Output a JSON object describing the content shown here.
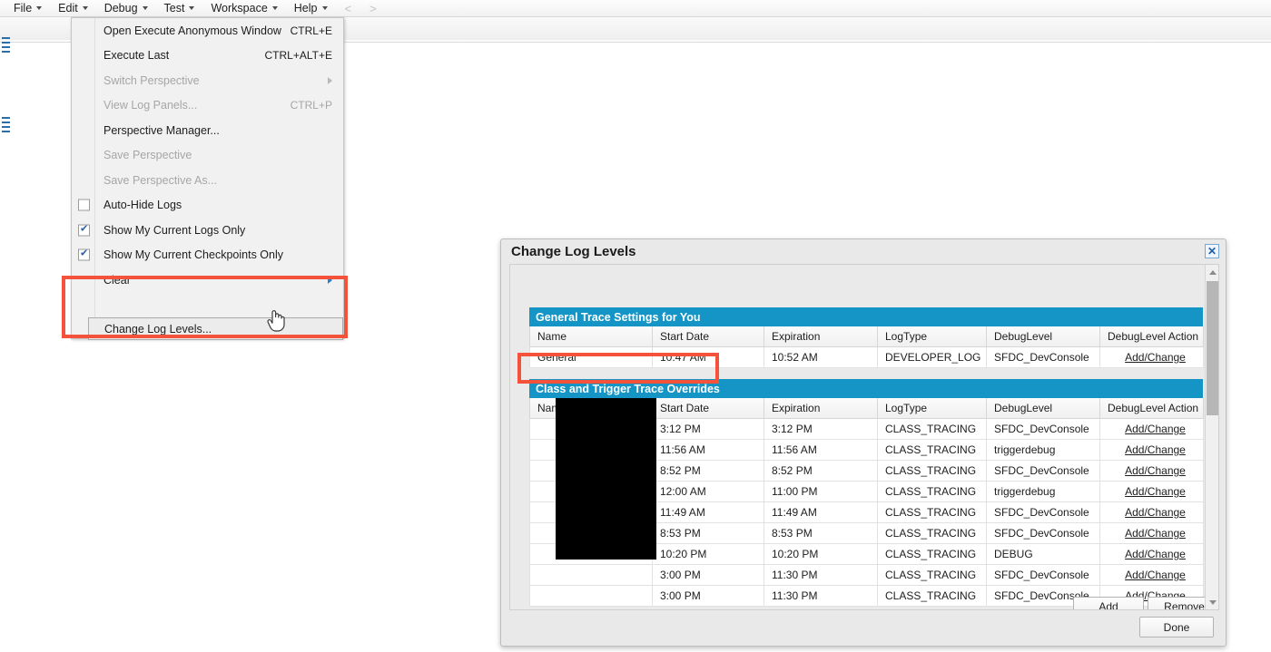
{
  "menubar": {
    "items": [
      {
        "label": "File"
      },
      {
        "label": "Edit"
      },
      {
        "label": "Debug"
      },
      {
        "label": "Test"
      },
      {
        "label": "Workspace"
      },
      {
        "label": "Help"
      }
    ],
    "nav_prev": "<",
    "nav_next": ">"
  },
  "debug_menu": {
    "items": [
      {
        "label": "Open Execute Anonymous Window",
        "accel": "CTRL+E",
        "disabled": false,
        "checkbox": null,
        "submenu": false
      },
      {
        "label": "Execute Last",
        "accel": "CTRL+ALT+E",
        "disabled": false,
        "checkbox": null,
        "submenu": false
      },
      {
        "label": "Switch Perspective",
        "accel": "",
        "disabled": true,
        "checkbox": null,
        "submenu": true
      },
      {
        "label": "View Log Panels...",
        "accel": "CTRL+P",
        "disabled": true,
        "checkbox": null,
        "submenu": false
      },
      {
        "label": "Perspective Manager...",
        "accel": "",
        "disabled": false,
        "checkbox": null,
        "submenu": false
      },
      {
        "label": "Save Perspective",
        "accel": "",
        "disabled": true,
        "checkbox": null,
        "submenu": false
      },
      {
        "label": "Save Perspective As...",
        "accel": "",
        "disabled": true,
        "checkbox": null,
        "submenu": false
      },
      {
        "label": "Auto-Hide Logs",
        "accel": "",
        "disabled": false,
        "checkbox": "unchecked",
        "submenu": false
      },
      {
        "label": "Show My Current Logs Only",
        "accel": "",
        "disabled": false,
        "checkbox": "checked",
        "submenu": false
      },
      {
        "label": "Show My Current Checkpoints Only",
        "accel": "",
        "disabled": false,
        "checkbox": "checked",
        "submenu": false
      },
      {
        "label": "Clear",
        "accel": "",
        "disabled": false,
        "checkbox": null,
        "submenu": true
      }
    ],
    "highlighted_item": "Change Log Levels..."
  },
  "dialog": {
    "title": "Change Log Levels",
    "close_icon": "✕",
    "columns": [
      "Name",
      "Start Date",
      "Expiration",
      "LogType",
      "DebugLevel",
      "DebugLevel Action"
    ],
    "general_section": {
      "header": "General Trace Settings for You",
      "rows": [
        {
          "name": "General",
          "start_date": "10:47 AM",
          "expiration": "10:52 AM",
          "expiration_state": "green",
          "log_type": "DEVELOPER_LOG",
          "debug_level": "SFDC_DevConsole",
          "action": "Add/Change"
        }
      ]
    },
    "overrides_section": {
      "header": "Class and Trigger Trace Overrides",
      "names_redacted": true,
      "rows": [
        {
          "name": "",
          "start_date": "3:12 PM",
          "expiration": "3:12 PM",
          "expiration_state": "red",
          "log_type": "CLASS_TRACING",
          "debug_level": "SFDC_DevConsole",
          "action": "Add/Change"
        },
        {
          "name": "",
          "start_date": "11:56 AM",
          "expiration": "11:56 AM",
          "expiration_state": "red",
          "log_type": "CLASS_TRACING",
          "debug_level": "triggerdebug",
          "action": "Add/Change"
        },
        {
          "name": "",
          "start_date": "8:52 PM",
          "expiration": "8:52 PM",
          "expiration_state": "red",
          "log_type": "CLASS_TRACING",
          "debug_level": "SFDC_DevConsole",
          "action": "Add/Change"
        },
        {
          "name": "",
          "start_date": "12:00 AM",
          "expiration": "11:00 PM",
          "expiration_state": "red",
          "log_type": "CLASS_TRACING",
          "debug_level": "triggerdebug",
          "action": "Add/Change"
        },
        {
          "name": "",
          "start_date": "11:49 AM",
          "expiration": "11:49 AM",
          "expiration_state": "red",
          "log_type": "CLASS_TRACING",
          "debug_level": "SFDC_DevConsole",
          "action": "Add/Change"
        },
        {
          "name": "",
          "start_date": "8:53 PM",
          "expiration": "8:53 PM",
          "expiration_state": "red",
          "log_type": "CLASS_TRACING",
          "debug_level": "SFDC_DevConsole",
          "action": "Add/Change"
        },
        {
          "name": "",
          "start_date": "10:20 PM",
          "expiration": "10:20 PM",
          "expiration_state": "red",
          "log_type": "CLASS_TRACING",
          "debug_level": "DEBUG",
          "action": "Add/Change"
        },
        {
          "name": "",
          "start_date": "3:00 PM",
          "expiration": "11:30 PM",
          "expiration_state": "red",
          "log_type": "CLASS_TRACING",
          "debug_level": "SFDC_DevConsole",
          "action": "Add/Change"
        },
        {
          "name": "",
          "start_date": "3:00 PM",
          "expiration": "11:30 PM",
          "expiration_state": "red",
          "log_type": "CLASS_TRACING",
          "debug_level": "SFDC_DevConsole",
          "action": "Add/Change"
        }
      ],
      "add_label": "Add",
      "remove_label": "Remove"
    },
    "third_section": {
      "header": ""
    },
    "done_label": "Done"
  },
  "colors": {
    "section_header_blue": "#1495c6",
    "expired_red": "#ff0000",
    "active_green": "#008000",
    "annotation_red": "#f4523b"
  }
}
